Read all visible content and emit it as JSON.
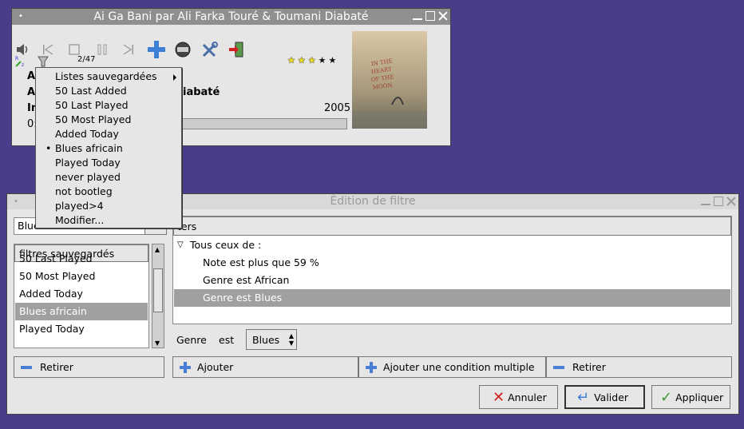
{
  "player": {
    "title": "Ai Ga Bani par Ali Farka Touré & Toumani Diabaté",
    "track_counter": "2/47",
    "rating_lit": 3,
    "rating_total": 5,
    "line1": "A",
    "line2_prefix": "A",
    "line2_suffix": "iabaté",
    "line3_prefix": "In",
    "year": "2005",
    "time_prefix": "0:",
    "progress_fraction": 0.0,
    "cover_text": "IN THE HEART OF THE MOON"
  },
  "menu": {
    "items": [
      {
        "label": "Listes sauvegardées",
        "submenu": true,
        "checked": false
      },
      {
        "label": "50 Last Added",
        "submenu": false,
        "checked": false
      },
      {
        "label": "50 Last Played",
        "submenu": false,
        "checked": false
      },
      {
        "label": "50 Most Played",
        "submenu": false,
        "checked": false
      },
      {
        "label": "Added Today",
        "submenu": false,
        "checked": false
      },
      {
        "label": "Blues africain",
        "submenu": false,
        "checked": true
      },
      {
        "label": "Played Today",
        "submenu": false,
        "checked": false
      },
      {
        "label": "never played",
        "submenu": false,
        "checked": false
      },
      {
        "label": "not bootleg",
        "submenu": false,
        "checked": false
      },
      {
        "label": "played>4",
        "submenu": false,
        "checked": false
      },
      {
        "label": "Modifier...",
        "submenu": false,
        "checked": false
      }
    ]
  },
  "editor": {
    "title": "Édition de filtre",
    "name_value": "Blues",
    "saved_header": "filtres sauvegardés",
    "saved_items": [
      "50 Last Played",
      "50 Most Played",
      "Added Today",
      "Blues africain",
      "Played Today"
    ],
    "selected_saved": "Blues africain",
    "filters_header": "ters",
    "tree": {
      "root": "Tous ceux de :",
      "conditions": [
        "Note est plus que 59 %",
        "Genre est African",
        "Genre est Blues"
      ],
      "selected": "Genre est Blues"
    },
    "cond_field": "Genre",
    "cond_op": "est",
    "cond_value": "Blues",
    "btn_remove_left": "Retirer",
    "btn_add": "Ajouter",
    "btn_add_multi": "Ajouter une condition multiple",
    "btn_remove_right": "Retirer",
    "btn_cancel": "Annuler",
    "btn_validate": "Valider",
    "btn_apply": "Appliquer"
  },
  "colors": {
    "desktop": "#483d8b",
    "window_bg": "#e6e6e6",
    "titlebar_active": "#8f8f8f",
    "selection": "#a0a0a0",
    "accent_blue": "#4a7ed4",
    "star_lit": "#f0e020"
  }
}
